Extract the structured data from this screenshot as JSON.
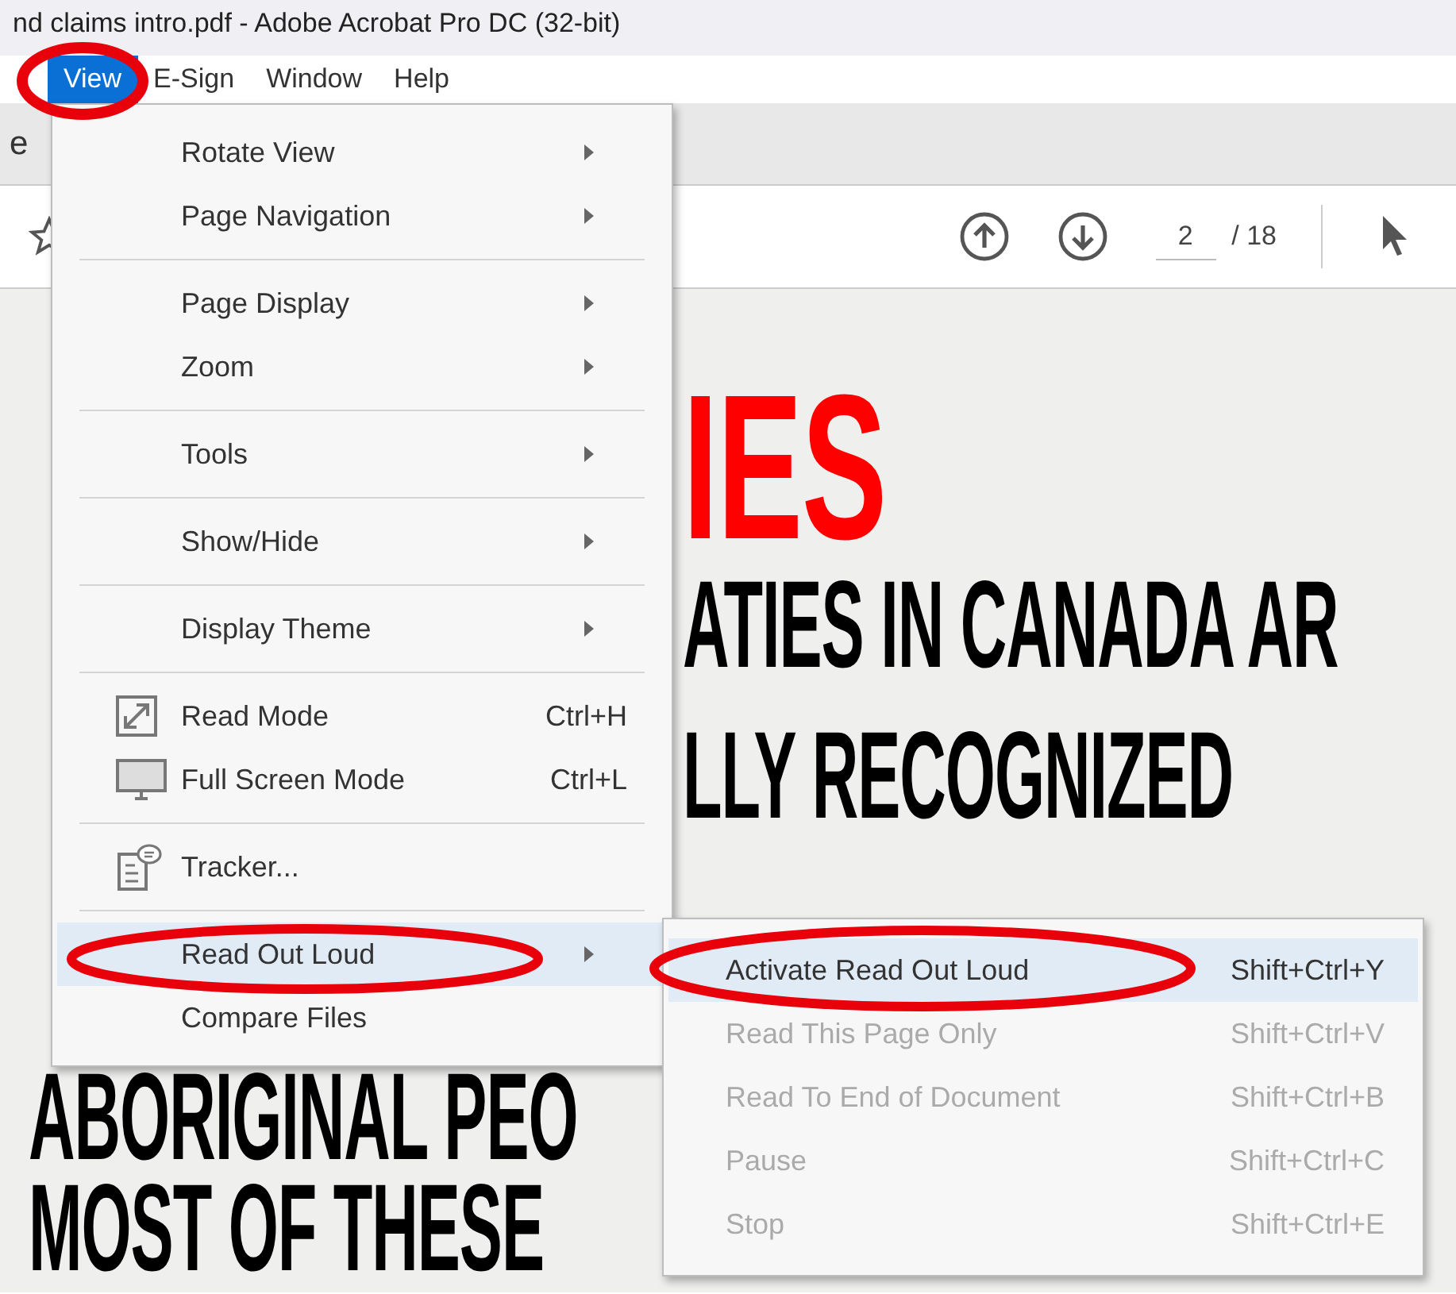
{
  "window": {
    "title": "nd claims intro.pdf - Adobe Acrobat Pro DC (32-bit)"
  },
  "menu_bar": [
    {
      "label": "View",
      "selected": true
    },
    {
      "label": "E-Sign",
      "selected": false
    },
    {
      "label": "Window",
      "selected": false
    },
    {
      "label": "Help",
      "selected": false
    }
  ],
  "tab_bar": {
    "label": "e"
  },
  "toolbar": {
    "page_number": "2",
    "page_count": "/ 18"
  },
  "document": {
    "heading": "IES",
    "lines": [
      {
        "right": "ATIES IN CANADA AR"
      },
      {
        "right": "LLY RECOGNIZED"
      },
      {
        "left": "ABORIGINAL PEO"
      },
      {
        "left": "MOST OF THESE"
      }
    ]
  },
  "view_menu": {
    "items": [
      {
        "kind": "submenu",
        "label": "Rotate View",
        "selected": false
      },
      {
        "kind": "submenu",
        "label": "Page Navigation",
        "selected": false
      },
      {
        "kind": "separator"
      },
      {
        "kind": "submenu",
        "label": "Page Display",
        "selected": false
      },
      {
        "kind": "submenu",
        "label": "Zoom",
        "selected": false
      },
      {
        "kind": "separator"
      },
      {
        "kind": "submenu",
        "label": "Tools",
        "selected": false
      },
      {
        "kind": "separator"
      },
      {
        "kind": "submenu",
        "label": "Show/Hide",
        "selected": false
      },
      {
        "kind": "separator"
      },
      {
        "kind": "submenu",
        "label": "Display Theme",
        "selected": false
      },
      {
        "kind": "separator"
      },
      {
        "kind": "readmode",
        "label": "Read Mode",
        "shortcut": "Ctrl+H",
        "selected": false
      },
      {
        "kind": "fullscreen",
        "label": "Full Screen Mode",
        "shortcut": "Ctrl+L",
        "selected": false
      },
      {
        "kind": "separator"
      },
      {
        "kind": "tracker",
        "label": "Tracker...",
        "selected": false
      },
      {
        "kind": "separator"
      },
      {
        "kind": "submenu",
        "label": "Read Out Loud",
        "selected": true
      },
      {
        "kind": "command",
        "label": "Compare Files",
        "selected": false
      }
    ]
  },
  "read_out_loud_submenu": {
    "items": [
      {
        "label": "Activate Read Out Loud",
        "shortcut": "Shift+Ctrl+Y",
        "selected": true,
        "disabled": false
      },
      {
        "label": "Read This Page Only",
        "shortcut": "Shift+Ctrl+V",
        "selected": false,
        "disabled": true
      },
      {
        "label": "Read To End of Document",
        "shortcut": "Shift+Ctrl+B",
        "selected": false,
        "disabled": true
      },
      {
        "label": "Pause",
        "shortcut": "Shift+Ctrl+C",
        "selected": false,
        "disabled": true
      },
      {
        "label": "Stop",
        "shortcut": "Shift+Ctrl+E",
        "selected": false,
        "disabled": true
      }
    ]
  }
}
